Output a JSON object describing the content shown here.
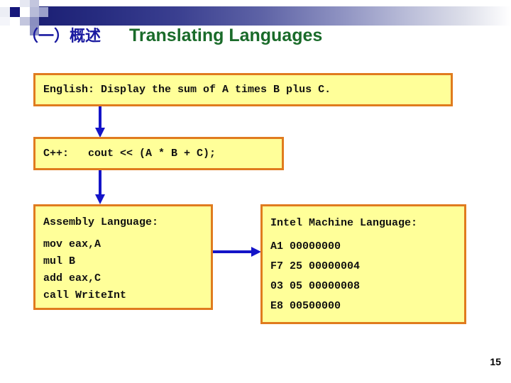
{
  "slide": {
    "page_number": "15",
    "title": {
      "chinese": "（一）概述",
      "english": "Translating Languages",
      "chinese_color": "#1a1aa0",
      "english_color": "#1a6b2a"
    },
    "theme": {
      "band_start_color": "#1b1f74",
      "band_end_color": "#ffffff",
      "box_fill": "#ffff99",
      "box_border": "#e07b1e",
      "label_color": "#cc2200",
      "arrow_color": "#1414c8"
    }
  },
  "boxes": {
    "english": {
      "label": "English:",
      "text": " Display the sum of A times B plus C."
    },
    "cpp": {
      "label": "C++:",
      "text": "   cout << (A * B + C);"
    },
    "assembly": {
      "label": "Assembly Language:",
      "lines": [
        "mov eax,A",
        "mul B",
        "add eax,C",
        "call WriteInt"
      ]
    },
    "machine": {
      "label": "Intel Machine Language:",
      "lines": [
        "A1 00000000",
        "F7 25 00000004",
        "03 05 00000008",
        "E8 00500000"
      ]
    }
  },
  "arrows": {
    "english_to_cpp": "down-arrow",
    "cpp_to_assembly": "down-arrow",
    "assembly_to_machine": "right-arrow"
  }
}
